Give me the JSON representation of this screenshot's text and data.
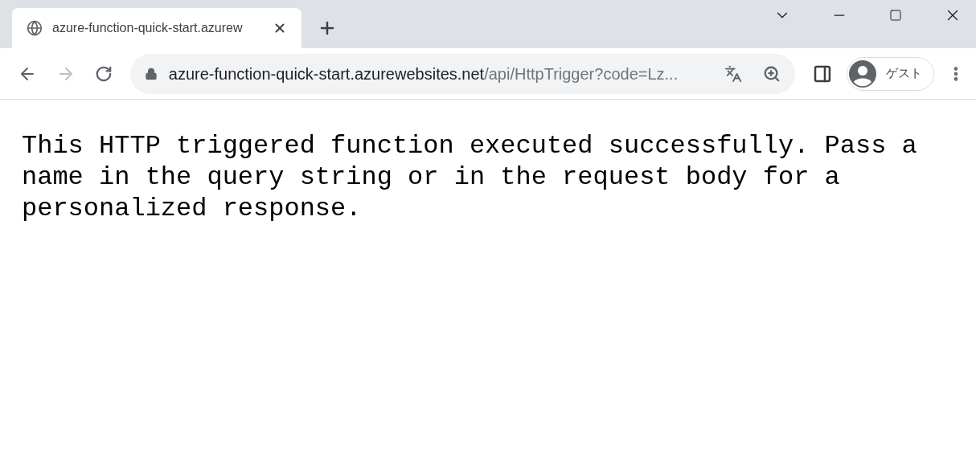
{
  "tabs": [
    {
      "title": "azure-function-quick-start.azurew",
      "selected": true
    }
  ],
  "address_bar": {
    "host": "azure-function-quick-start.azurewebsites.net",
    "path": "/api/HttpTrigger?code=Lz..."
  },
  "profile": {
    "label": "ゲスト"
  },
  "page": {
    "text": "This HTTP triggered function executed successfully. Pass a name in the query string or in the request body for a personalized response."
  }
}
